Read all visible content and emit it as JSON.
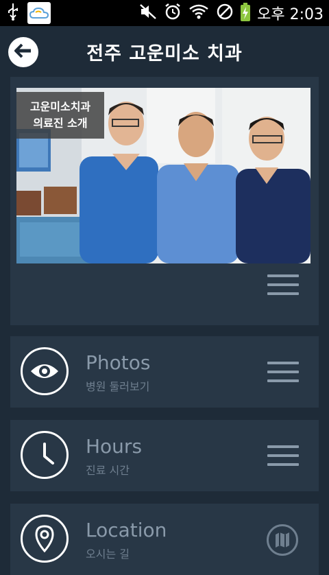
{
  "status_bar": {
    "time": "오후 2:03",
    "icons": [
      "usb-icon",
      "weather-cloud-icon",
      "mute-icon",
      "alarm-icon",
      "wifi-icon",
      "no-signal-icon",
      "battery-charging-icon"
    ],
    "battery_color": "#8dc63f"
  },
  "header": {
    "title": "전주 고운미소 치과",
    "back_icon": "back-arrow-icon"
  },
  "hero": {
    "caption_line1": "고운미소치과",
    "caption_line2": "의료진 소개",
    "menu_icon": "hamburger-menu-icon"
  },
  "cards": [
    {
      "title": "Photos",
      "subtitle": "병원 둘러보기",
      "icon": "eye-icon",
      "action_icon": "hamburger-menu-icon"
    },
    {
      "title": "Hours",
      "subtitle": "진료 시간",
      "icon": "clock-icon",
      "action_icon": "hamburger-menu-icon"
    },
    {
      "title": "Location",
      "subtitle": "오시는 길",
      "icon": "location-pin-icon",
      "action_icon": "map-icon"
    }
  ],
  "colors": {
    "background": "#1e2b38",
    "card": "#283746",
    "title_muted": "#8a9aaa",
    "subtitle_muted": "#6f7f8f"
  }
}
